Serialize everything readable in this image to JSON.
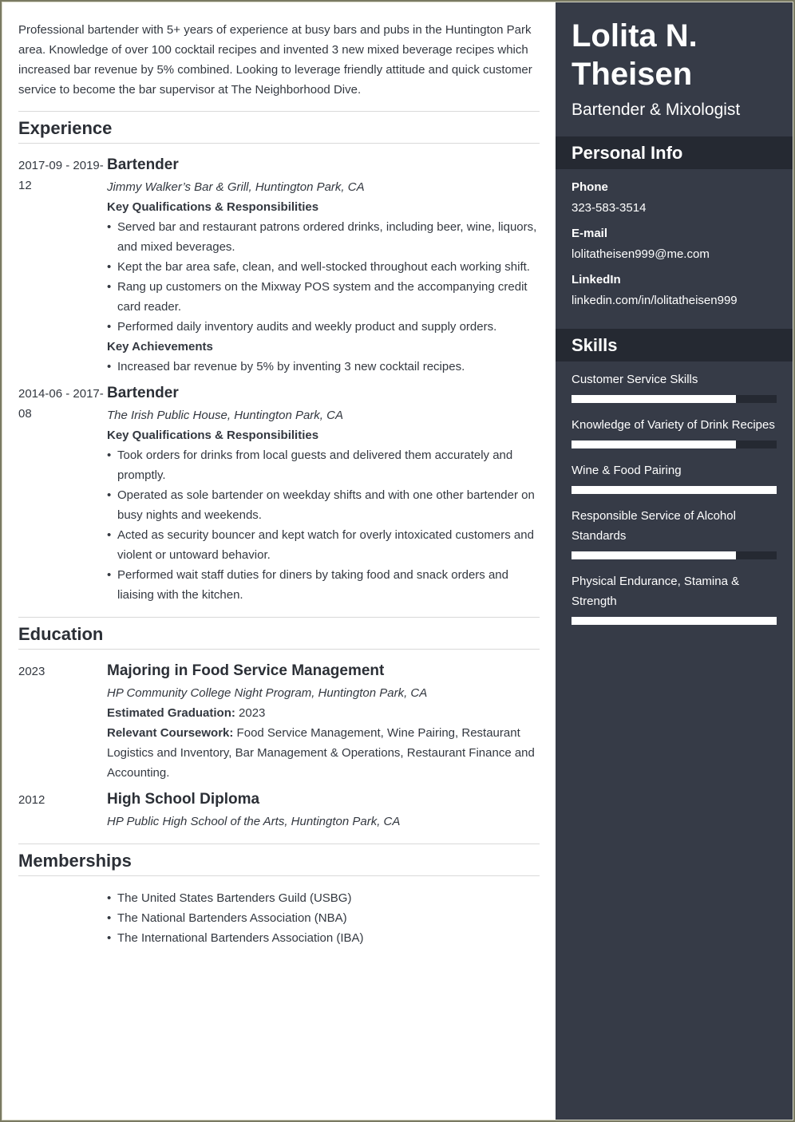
{
  "summary": "Professional bartender with 5+ years of experience at busy bars and pubs in the Huntington Park area. Knowledge of over 100 cocktail recipes and invented 3 new mixed beverage recipes which increased bar revenue by 5% combined. Looking to leverage friendly attitude and quick customer service to become the bar supervisor at The Neighborhood Dive.",
  "experience": {
    "heading": "Experience",
    "jobs": [
      {
        "date": "2017-09 - 2019-12",
        "title": "Bartender",
        "org": "Jimmy Walker’s Bar & Grill, Huntington Park, CA",
        "resp_heading": "Key Qualifications & Responsibilities",
        "responsibilities": [
          "Served bar and restaurant patrons ordered drinks, including beer, wine, liquors, and mixed beverages.",
          "Kept the bar area safe, clean, and well-stocked throughout each working shift.",
          "Rang up customers on the Mixway POS system and the accompanying credit card reader.",
          "Performed daily inventory audits and weekly product and supply orders."
        ],
        "ach_heading": "Key Achievements",
        "achievements": [
          "Increased bar revenue by 5% by inventing 3 new cocktail recipes."
        ]
      },
      {
        "date": "2014-06 - 2017-08",
        "title": "Bartender",
        "org": "The Irish Public House, Huntington Park, CA",
        "resp_heading": "Key Qualifications & Responsibilities",
        "responsibilities": [
          "Took orders for drinks from local guests and delivered them accurately and promptly.",
          "Operated as sole bartender on weekday shifts and with one other bartender on busy nights and weekends.",
          "Acted as security bouncer and kept watch for overly intoxicated customers and violent or untoward behavior.",
          "Performed wait staff duties for diners by taking food and snack orders and liaising with the kitchen."
        ]
      }
    ]
  },
  "education": {
    "heading": "Education",
    "items": [
      {
        "date": "2023",
        "title": "Majoring in Food Service Management",
        "org": "HP Community College Night Program, Huntington Park, CA",
        "grad_label": "Estimated Graduation:",
        "grad_value": " 2023",
        "course_label": "Relevant Coursework:",
        "course_value": " Food Service Management, Wine Pairing, Restaurant Logistics and Inventory, Bar Management & Operations, Restaurant Finance and Accounting."
      },
      {
        "date": "2012",
        "title": "High School Diploma",
        "org": "HP Public High School of the Arts, Huntington Park, CA"
      }
    ]
  },
  "memberships": {
    "heading": "Memberships",
    "items": [
      "The United States Bartenders Guild (USBG)",
      "The National Bartenders Association (NBA)",
      "The International Bartenders Association (IBA)"
    ]
  },
  "sidebar": {
    "name": "Lolita N. Theisen",
    "role": "Bartender & Mixologist",
    "personal_heading": "Personal Info",
    "phone_label": "Phone",
    "phone": "323-583-3514",
    "email_label": "E-mail",
    "email": "lolitatheisen999@me.com",
    "linkedin_label": "LinkedIn",
    "linkedin": "linkedin.com/in/lolitatheisen999",
    "skills_heading": "Skills",
    "skills": [
      {
        "name": "Customer Service Skills",
        "level": 0.8
      },
      {
        "name": "Knowledge of Variety of Drink Recipes",
        "level": 0.8
      },
      {
        "name": "Wine & Food Pairing",
        "level": 1.0
      },
      {
        "name": "Responsible Service of Alcohol Standards",
        "level": 0.8
      },
      {
        "name": "Physical Endurance, Stamina & Strength",
        "level": 1.0
      }
    ]
  },
  "colors": {
    "sidebar_bg": "#363b47",
    "sidebar_head_bg": "#252932",
    "text": "#2b2f36"
  }
}
